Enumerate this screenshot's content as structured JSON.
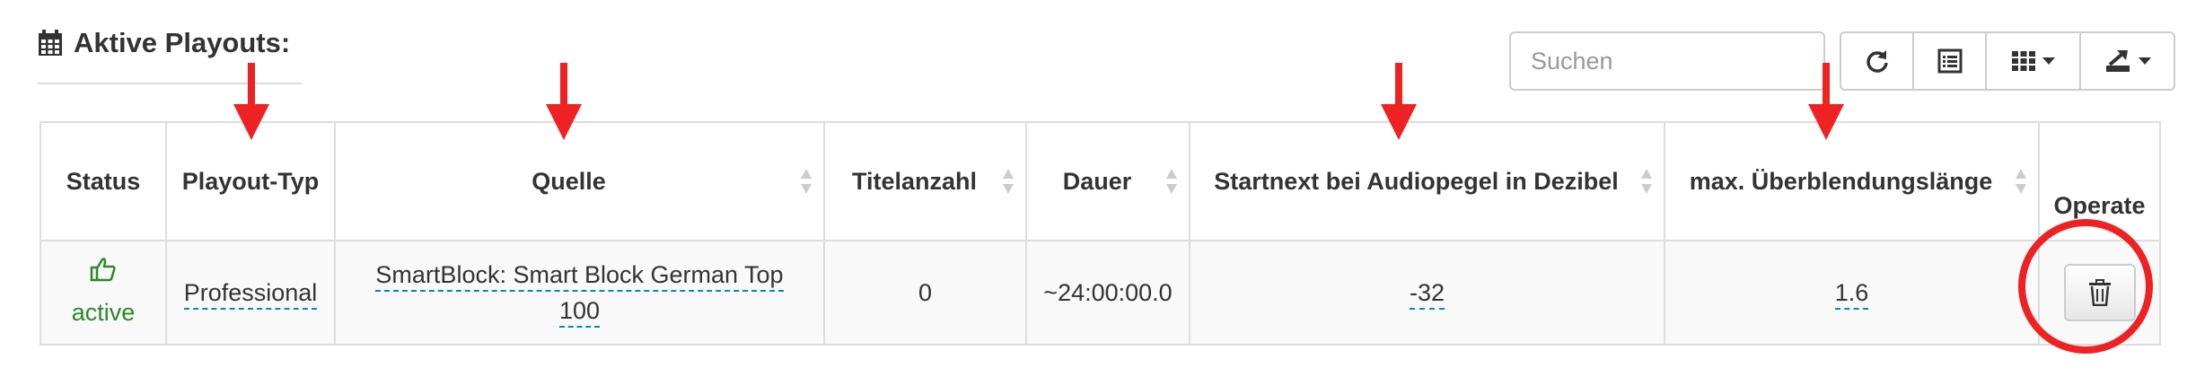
{
  "section": {
    "title": "Aktive Playouts:",
    "icon": "calendar-icon"
  },
  "toolbar": {
    "search_placeholder": "Suchen",
    "buttons": [
      {
        "icon": "refresh-icon"
      },
      {
        "icon": "list-icon"
      },
      {
        "icon": "grid-columns-icon"
      },
      {
        "icon": "export-icon"
      }
    ]
  },
  "table": {
    "headers": {
      "status": "Status",
      "playout_type": "Playout-Typ",
      "source": "Quelle",
      "title_count": "Titelanzahl",
      "duration": "Dauer",
      "startnext": "Startnext bei Audiopegel in Dezibel",
      "crossfade": "max. Überblendungslänge",
      "operate": "Operate"
    },
    "rows": [
      {
        "status": "active",
        "status_icon": "thumbs-up-icon",
        "playout_type": "Professional",
        "source_line1": "SmartBlock: Smart Block German Top",
        "source_line2": "100",
        "title_count": "0",
        "duration": "~24:00:00.0",
        "startnext": "-32",
        "crossfade": "1.6",
        "delete_icon": "trash-icon"
      }
    ]
  },
  "colors": {
    "annotation": "#ee2222",
    "status_active": "#2a8a2a",
    "editable_underline": "#0088cc"
  }
}
